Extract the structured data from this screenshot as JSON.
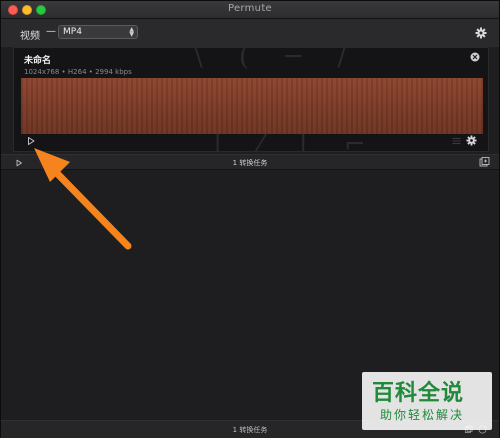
{
  "window": {
    "title": "Permute"
  },
  "toolbar": {
    "preset_label": "视频",
    "preset_dash": "—",
    "preset_value": "MP4",
    "settings_icon": "gear-icon"
  },
  "item": {
    "title": "未命名",
    "meta": "1024x768 • H264 • 2994 kbps",
    "close_icon": "close-circle-icon",
    "play_icon": "play-icon",
    "list_icon": "list-icon",
    "settings_icon": "gear-icon",
    "thumbnail_color": "#7a3a26"
  },
  "status": {
    "text": "1 转换任务",
    "play_icon": "play-icon",
    "add_icon": "add-files-icon"
  },
  "footer": {
    "text": "1 转换任务"
  },
  "annotation": {
    "arrow_color": "#f5841f",
    "arrow_icon": "arrow-pointer-icon"
  },
  "watermark": {
    "main": "百科全说",
    "sub": "助你轻松解决",
    "color": "#1f8a3a"
  }
}
